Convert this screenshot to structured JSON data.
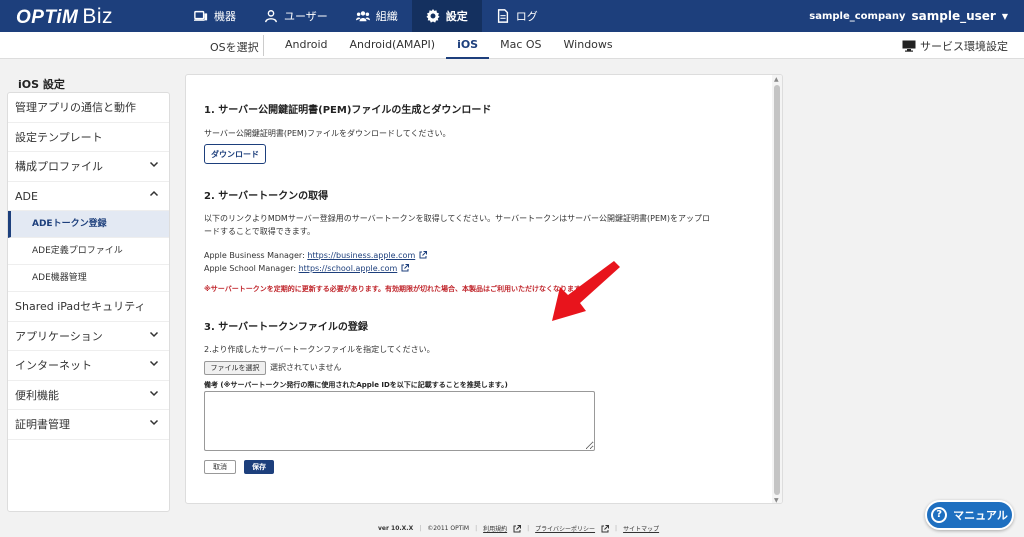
{
  "header": {
    "logo_optim": "OPTiM",
    "logo_biz": "Biz",
    "nav": [
      {
        "label": "機器",
        "icon": "devices-icon"
      },
      {
        "label": "ユーザー",
        "icon": "user-icon"
      },
      {
        "label": "組織",
        "icon": "organization-icon"
      },
      {
        "label": "設定",
        "icon": "gear-icon"
      },
      {
        "label": "ログ",
        "icon": "log-icon"
      }
    ],
    "active_nav": "設定",
    "company": "sample_company",
    "user": "sample_user"
  },
  "subnav": {
    "os_select_label": "OSを選択",
    "tabs": [
      "Android",
      "Android(AMAPI)",
      "iOS",
      "Mac OS",
      "Windows"
    ],
    "active_tab": "iOS",
    "service_env": "サービス環境設定"
  },
  "sidebar": {
    "title": "iOS 設定",
    "items": [
      {
        "label": "管理アプリの通信と動作",
        "chevron": ""
      },
      {
        "label": "設定テンプレート",
        "chevron": ""
      },
      {
        "label": "構成プロファイル",
        "chevron": "down"
      },
      {
        "label": "ADE",
        "chevron": "up"
      },
      {
        "label": "ADEトークン登録",
        "sub": true,
        "active": true
      },
      {
        "label": "ADE定義プロファイル",
        "sub": true
      },
      {
        "label": "ADE機器管理",
        "sub": true
      },
      {
        "label": "Shared iPadセキュリティ",
        "chevron": ""
      },
      {
        "label": "アプリケーション",
        "chevron": "down"
      },
      {
        "label": "インターネット",
        "chevron": "down"
      },
      {
        "label": "便利機能",
        "chevron": "down"
      },
      {
        "label": "証明書管理",
        "chevron": "down"
      }
    ]
  },
  "main": {
    "section1": {
      "title": "1. サーバー公開鍵証明書(PEM)ファイルの生成とダウンロード",
      "desc": "サーバー公開鍵証明書(PEM)ファイルをダウンロードしてください。",
      "download_label": "ダウンロード"
    },
    "section2": {
      "title": "2. サーバートークンの取得",
      "desc_line1": "以下のリンクよりMDMサーバー登録用のサーバートークンを取得してください。サーバートークンはサーバー公開鍵証明書(PEM)をアップロ",
      "desc_line2": "ードすることで取得できます。",
      "abm_label": "Apple Business Manager: ",
      "abm_link": "https://business.apple.com",
      "asm_label": "Apple School Manager: ",
      "asm_link": "https://school.apple.com",
      "warning": "※サーバートークンを定期的に更新する必要があります。有効期限が切れた場合、本製品はご利用いただけなくなります。"
    },
    "section3": {
      "title": "3. サーバートークンファイルの登録",
      "desc": "2.より作成したサーバートークンファイルを指定してください。",
      "file_button": "ファイルを選択",
      "file_status": "選択されていません",
      "note_label": "備考 (※サーバートークン発行の際に使用されたApple IDを以下に記載することを推奨します。)",
      "note_value": "",
      "cancel_label": "取消",
      "save_label": "保存"
    }
  },
  "footer": {
    "version": "ver 10.X.X",
    "copyright": "©2011 OPTiM",
    "terms": "利用規約",
    "privacy": "プライバシーポリシー",
    "sitemap": "サイトマップ"
  },
  "manual_button": "マニュアル",
  "colors": {
    "brand": "#1d3f7c",
    "warning": "#c0262c",
    "annotation_arrow": "#e8141c",
    "manual": "#1e6fc0"
  }
}
